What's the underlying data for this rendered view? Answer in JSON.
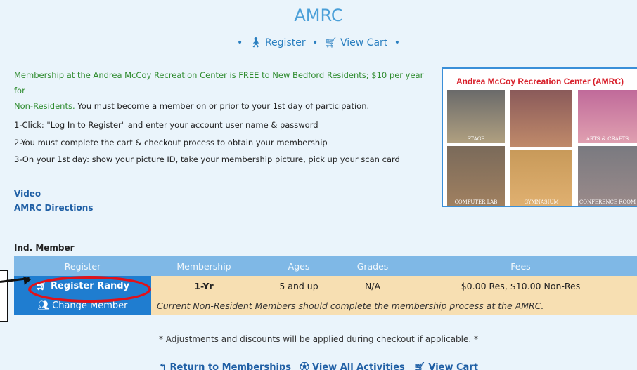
{
  "page": {
    "title": "AMRC",
    "nav": {
      "bullet": "•",
      "register": "Register",
      "view_cart": "View Cart"
    }
  },
  "description": {
    "green_text_1": "Membership at the Andrea McCoy Recreation Center is FREE to New Bedford Residents; $10 per year for",
    "green_text_2": "Non-Residents.",
    "rest_text": " You must become a member on or prior to your 1st day of participation.",
    "steps": [
      "1-Click: \"Log In to Register\" and enter your account user name & password",
      "2-You must complete the cart & checkout process to obtain your membership",
      "3-On your 1st day: show your picture ID, take your membership picture, pick up your scan card"
    ]
  },
  "links": {
    "video": "Video",
    "directions": "AMRC Directions"
  },
  "photo": {
    "title": "Andrea McCoy Recreation Center (AMRC)",
    "tiles": [
      "STAGE",
      "ARTS & CRAFTS",
      "COMPUTER LAB",
      "GYMNASIUM",
      "CONFERENCE ROOM"
    ]
  },
  "section": {
    "title": "Ind. Member"
  },
  "table": {
    "headers": [
      "Register",
      "Membership",
      "Ages",
      "Grades",
      "Fees"
    ],
    "register_button": "Register Randy",
    "change_button": "Change Member",
    "membership": "1-Yr",
    "ages": "5 and up",
    "grades": "N/A",
    "fees": "$0.00 Res, $10.00 Non-Res",
    "note": "Current Non-Resident Members should complete the membership process at the AMRC."
  },
  "footer": {
    "adjustments": "* Adjustments and discounts will be applied during checkout if applicable. *",
    "return": "Return to Memberships",
    "view_all": "View All Activities",
    "view_cart": "View Cart"
  },
  "colors": {
    "accent_blue": "#1f7dd0",
    "header_blue": "#7fb8e6",
    "row_tan": "#f7dfb2",
    "annotation_red": "#e0121a"
  }
}
